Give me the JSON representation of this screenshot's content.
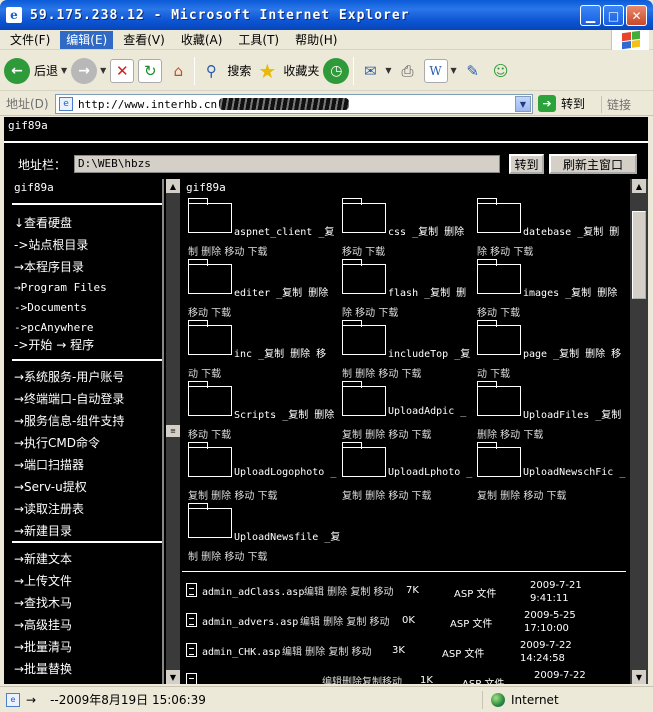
{
  "window": {
    "title": "59.175.238.12 - Microsoft Internet Explorer",
    "title_icon": "e",
    "minimize_icon": "minimize-icon",
    "maximize_icon": "maximize-icon",
    "close_icon": "close-icon"
  },
  "menu": {
    "items": [
      "文件(F)",
      "编辑(E)",
      "查看(V)",
      "收藏(A)",
      "工具(T)",
      "帮助(H)"
    ],
    "active_index": 1
  },
  "toolbar": {
    "back_label": "后退",
    "search_label": "搜索",
    "favorites_label": "收藏夹"
  },
  "address": {
    "label": "地址(D)",
    "url": "http://www.interhb.cn",
    "go_label": "转到",
    "links_label": "链接"
  },
  "page": {
    "top_label": "gif89a",
    "path_label": "地址栏：",
    "path_value": "D:\\WEB\\hbzs",
    "goto_button": "转到",
    "refresh_button": "刷新主窗口"
  },
  "left": {
    "head": "gif89a",
    "group1": [
      "↓查看硬盘",
      "->站点根目录",
      "→本程序目录",
      "→Program Files",
      "->Documents",
      "->pcAnywhere",
      "->开始 → 程序"
    ],
    "group2": [
      "→系统服务-用户账号",
      "→终端端口-自动登录",
      "→服务信息-组件支持",
      "→执行CMD命令",
      "→端口扫描器",
      "→Serv-u提权",
      "→读取注册表",
      "→新建目录"
    ],
    "group3": [
      "→新建文本",
      "→上传文件",
      "→查找木马",
      "→高级挂马",
      "→批量清马",
      "→批量替换"
    ]
  },
  "right": {
    "head": "gif89a",
    "folders": [
      {
        "name": "aspnet_client",
        "ops_a": "_复",
        "ops_b": "制 删除 移动 下载"
      },
      {
        "name": "css",
        "ops_a": "_复制 删除",
        "ops_b": "移动 下载"
      },
      {
        "name": "datebase",
        "ops_a": "_复制 删",
        "ops_b": "除 移动 下载"
      },
      {
        "name": "editer",
        "ops_a": "_复制 删除",
        "ops_b": "移动 下载"
      },
      {
        "name": "flash",
        "ops_a": "_复制 删",
        "ops_b": "除 移动 下载"
      },
      {
        "name": "images",
        "ops_a": "_复制 删除",
        "ops_b": "移动 下载"
      },
      {
        "name": "inc",
        "ops_a": "_复制 删除 移",
        "ops_b": "动 下载"
      },
      {
        "name": "includeTop",
        "ops_a": "_复",
        "ops_b": "制 删除 移动 下载"
      },
      {
        "name": "page",
        "ops_a": "_复制 删除 移",
        "ops_b": "动 下载"
      },
      {
        "name": "Scripts",
        "ops_a": "_复制 删除",
        "ops_b": "移动 下载"
      },
      {
        "name": "UploadAdpic",
        "ops_a": "_",
        "ops_b": "复制 删除 移动 下载"
      },
      {
        "name": "UploadFiles",
        "ops_a": "_复制",
        "ops_b": "删除 移动 下载"
      },
      {
        "name": "UploadLogophoto",
        "ops_a": "_",
        "ops_b": "复制 删除 移动 下载"
      },
      {
        "name": "UploadLphoto",
        "ops_a": "_",
        "ops_b": "复制 删除 移动 下载"
      },
      {
        "name": "UploadNewschFic",
        "ops_a": "_",
        "ops_b": "复制 删除 移动 下载"
      },
      {
        "name": "UploadNewsfile",
        "ops_a": "_复",
        "ops_b": "制 删除 移动 下载"
      }
    ],
    "files": [
      {
        "name": "admin_adClass.asp",
        "ops": "编辑 删除 复制 移动",
        "size": "7K",
        "type": "ASP 文件",
        "date": "2009-7-21",
        "time": "9:41:11"
      },
      {
        "name": "admin_advers.asp",
        "ops": "编辑 删除 复制 移动",
        "size": "0K",
        "type": "ASP 文件",
        "date": "2009-5-25",
        "time": "17:10:00"
      },
      {
        "name": "admin_CHK.asp",
        "ops": "编辑 删除 复制 移动",
        "size": "3K",
        "type": "ASP 文件",
        "date": "2009-7-22",
        "time": "14:24:58"
      },
      {
        "name": "",
        "ops": "编辑删除复制移动",
        "size": "1K",
        "type": "ASP 文件",
        "date": "2009-7-22",
        "time": ""
      }
    ]
  },
  "status": {
    "text": "--2009年8月19日 15:06:39",
    "zone": "Internet"
  }
}
